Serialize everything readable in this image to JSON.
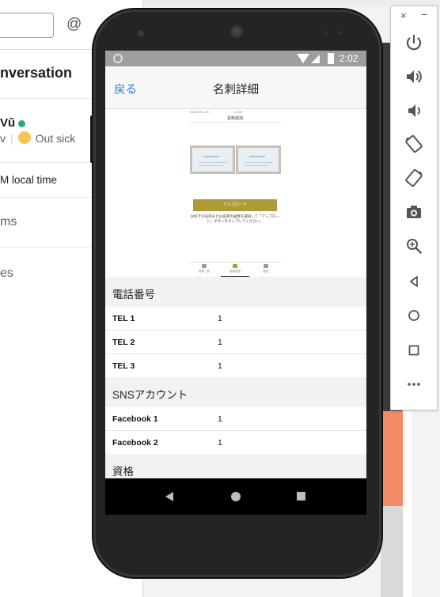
{
  "slack": {
    "at_symbol": "@",
    "conversation_title": "nversation",
    "user_name": "Vũ",
    "user_sub_prefix": "v",
    "status_text": "Out sick",
    "local_time": "M local time",
    "items_label": "ms",
    "files_label": "es"
  },
  "emulator": {
    "close_symbol": "×",
    "minimize_symbol": "−",
    "buttons": [
      "power-icon",
      "volume-up-icon",
      "volume-down-icon",
      "rotate-left-icon",
      "rotate-right-icon",
      "camera-icon",
      "zoom-icon",
      "back-icon",
      "home-icon",
      "overview-icon",
      "more-icon"
    ]
  },
  "device": {
    "status_time": "2:02",
    "nav_back_label": "戻る",
    "nav_title": "名刺詳細",
    "preview": {
      "mini_status_left": "KDDI 4G LTE",
      "mini_status_time": "17:23",
      "mini_title": "名刺追加",
      "upload_label": "アップロード",
      "instruction": "お好きな名刺または名刺の画像を選択して「アップロード」ボタンをタップしてください。",
      "tabs": [
        "名刺一覧",
        "名刺追加",
        "設定"
      ]
    },
    "sections": [
      {
        "header": "電話番号",
        "rows": [
          {
            "key": "TEL 1",
            "value": "1"
          },
          {
            "key": "TEL 2",
            "value": "1"
          },
          {
            "key": "TEL 3",
            "value": "1"
          }
        ]
      },
      {
        "header": "SNSアカウント",
        "rows": [
          {
            "key": "Facebook 1",
            "value": "1"
          },
          {
            "key": "Facebook 2",
            "value": "1"
          }
        ]
      },
      {
        "header": "資格",
        "rows": []
      }
    ]
  }
}
